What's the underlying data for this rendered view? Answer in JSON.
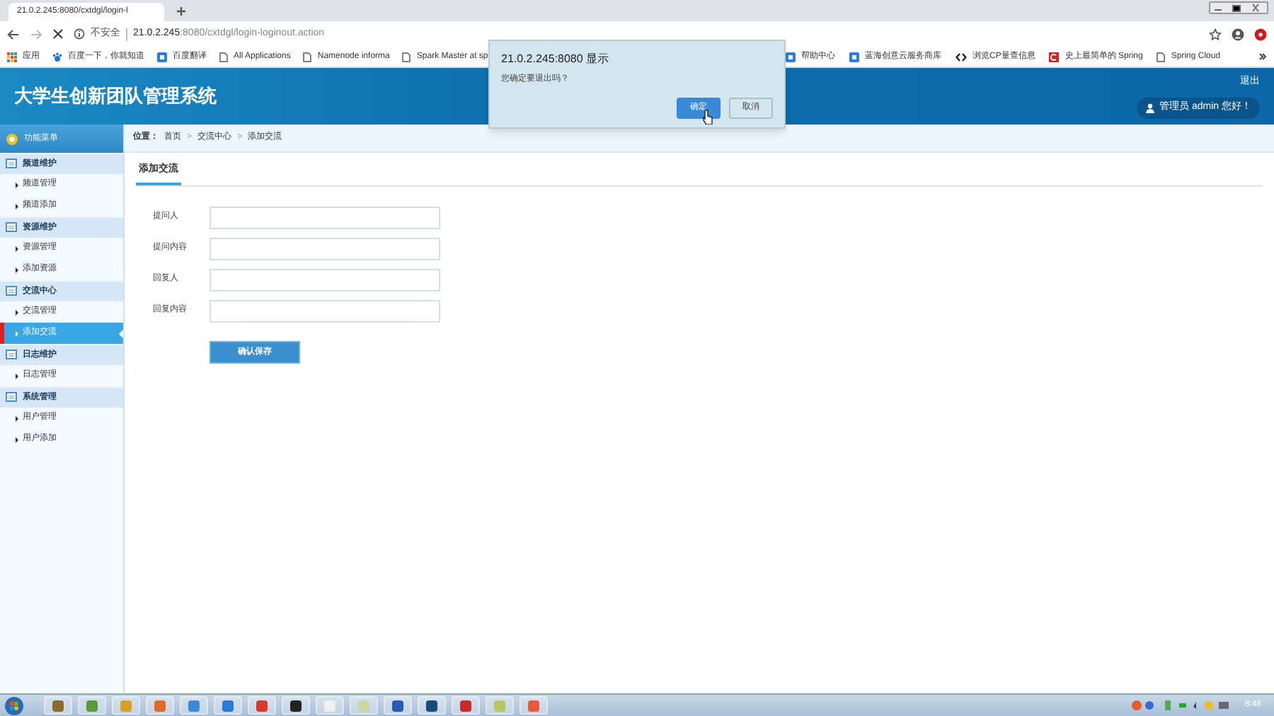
{
  "browser": {
    "tab_title": "21.0.2.245:8080/cxtdgl/login-l",
    "security": "不安全",
    "url_host": "21.0.2.245",
    "url_rest": ":8080/cxtdgl/login-loginout.action",
    "bookmarks": [
      {
        "label": "应用",
        "kind": "apps"
      },
      {
        "label": "百度一下，你就知道",
        "kind": "paw"
      },
      {
        "label": "百度翻译",
        "kind": "square"
      },
      {
        "label": "All Applications",
        "kind": "page"
      },
      {
        "label": "Namenode informa",
        "kind": "page"
      },
      {
        "label": "Spark Master at sp",
        "kind": "page"
      },
      {
        "label": "帮助中心",
        "kind": "square"
      },
      {
        "label": "蓝海创意云服务商库",
        "kind": "square"
      },
      {
        "label": "浏览CP量查信息",
        "kind": "code"
      },
      {
        "label": "史上最简单的 Spring",
        "kind": "red"
      },
      {
        "label": "Spring Cloud",
        "kind": "page"
      }
    ]
  },
  "header": {
    "title": "大学生创新团队管理系统",
    "logout": "退出",
    "greeting": "管理员 admin 您好！"
  },
  "sidebar": {
    "title": "功能菜单",
    "groups": [
      {
        "label": "频道维护",
        "items": [
          {
            "label": "频道管理",
            "selected": false
          },
          {
            "label": "频道添加",
            "selected": false
          }
        ]
      },
      {
        "label": "资源维护",
        "items": [
          {
            "label": "资源管理",
            "selected": false
          },
          {
            "label": "添加资源",
            "selected": false
          }
        ]
      },
      {
        "label": "交流中心",
        "items": [
          {
            "label": "交流管理",
            "selected": false
          },
          {
            "label": "添加交流",
            "selected": true
          }
        ]
      },
      {
        "label": "日志维护",
        "items": [
          {
            "label": "日志管理",
            "selected": false
          }
        ]
      },
      {
        "label": "系统管理",
        "items": [
          {
            "label": "用户管理",
            "selected": false
          },
          {
            "label": "用户添加",
            "selected": false
          }
        ]
      }
    ]
  },
  "breadcrumb": {
    "label": "位置：",
    "separator": ">",
    "items": [
      "首页",
      "交流中心",
      "添加交流"
    ]
  },
  "form": {
    "tab": "添加交流",
    "fields": [
      {
        "label": "提问人"
      },
      {
        "label": "提问内容"
      },
      {
        "label": "回复人"
      },
      {
        "label": "回复内容"
      }
    ],
    "submit": "确认保存"
  },
  "dialog": {
    "title": "21.0.2.245:8080 显示",
    "message": "您确定要退出吗？",
    "buttons": [
      {
        "label": "确定",
        "kind": "primary"
      },
      {
        "label": "取消",
        "kind": "secondary"
      }
    ]
  },
  "taskbar": {
    "apps": [
      {
        "color": "#8a6d2a"
      },
      {
        "color": "#5a9a3a"
      },
      {
        "color": "#d9a020"
      },
      {
        "color": "#e06a20"
      },
      {
        "color": "#3a8ad8"
      },
      {
        "color": "#2a7ad8"
      },
      {
        "color": "#d83a2a"
      },
      {
        "color": "#222222"
      },
      {
        "color": "#f0f0f0"
      },
      {
        "color": "#c8d8a0"
      },
      {
        "color": "#2a5ab8"
      },
      {
        "color": "#1a4a7a"
      },
      {
        "color": "#c82a2a"
      },
      {
        "color": "#b8c860"
      },
      {
        "color": "#e85a3a"
      }
    ],
    "clock": "8:48"
  }
}
